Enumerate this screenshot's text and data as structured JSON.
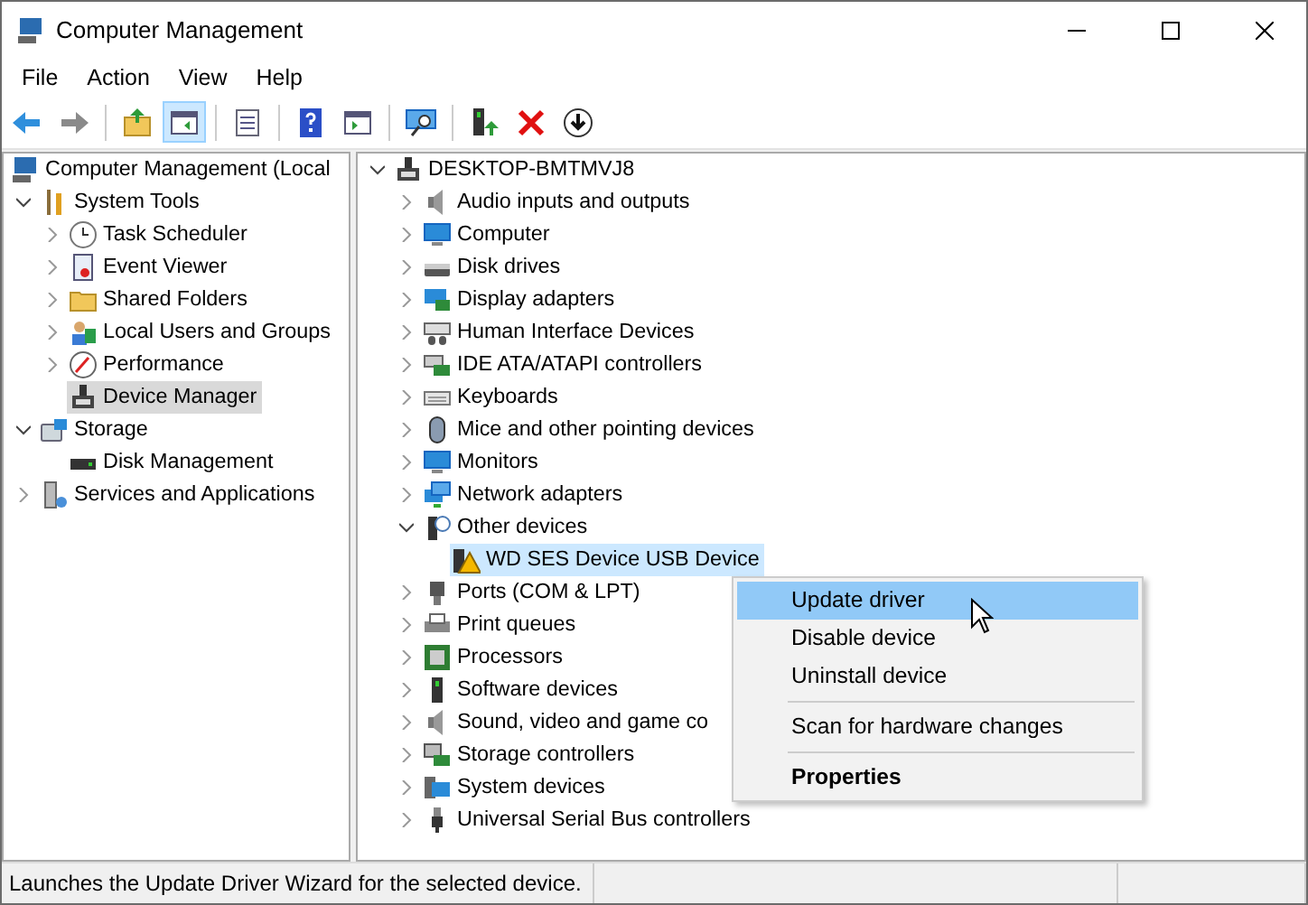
{
  "window": {
    "title": "Computer Management"
  },
  "menu_bar": [
    "File",
    "Action",
    "View",
    "Help"
  ],
  "console_tree": [
    {
      "label": "Computer Management (Local",
      "selected": false,
      "children": [
        {
          "label": "System Tools",
          "expanded": true,
          "selected": false,
          "children": [
            {
              "label": "Task Scheduler",
              "expanded": false,
              "selected": false
            },
            {
              "label": "Event Viewer",
              "expanded": false,
              "selected": false
            },
            {
              "label": "Shared Folders",
              "expanded": false,
              "selected": false
            },
            {
              "label": "Local Users and Groups",
              "expanded": false,
              "selected": false
            },
            {
              "label": "Performance",
              "expanded": false,
              "selected": false
            },
            {
              "label": "Device Manager",
              "selected": true
            }
          ]
        },
        {
          "label": "Storage",
          "expanded": true,
          "selected": false,
          "children": [
            {
              "label": "Disk Management",
              "selected": false
            }
          ]
        },
        {
          "label": "Services and Applications",
          "expanded": false,
          "selected": false
        }
      ]
    }
  ],
  "device_tree": [
    {
      "label": "DESKTOP-BMTMVJ8",
      "expanded": true,
      "selected": false,
      "children": [
        {
          "label": "Audio inputs and outputs",
          "expanded": false,
          "selected": false
        },
        {
          "label": "Computer",
          "expanded": false,
          "selected": false
        },
        {
          "label": "Disk drives",
          "expanded": false,
          "selected": false
        },
        {
          "label": "Display adapters",
          "expanded": false,
          "selected": false
        },
        {
          "label": "Human Interface Devices",
          "expanded": false,
          "selected": false
        },
        {
          "label": "IDE ATA/ATAPI controllers",
          "expanded": false,
          "selected": false
        },
        {
          "label": "Keyboards",
          "expanded": false,
          "selected": false
        },
        {
          "label": "Mice and other pointing devices",
          "expanded": false,
          "selected": false
        },
        {
          "label": "Monitors",
          "expanded": false,
          "selected": false
        },
        {
          "label": "Network adapters",
          "expanded": false,
          "selected": false
        },
        {
          "label": "Other devices",
          "expanded": true,
          "selected": false,
          "children": [
            {
              "label": "WD SES Device USB Device",
              "selected": true
            }
          ]
        },
        {
          "label": "Ports (COM & LPT)",
          "expanded": false,
          "selected": false
        },
        {
          "label": "Print queues",
          "expanded": false,
          "selected": false
        },
        {
          "label": "Processors",
          "expanded": false,
          "selected": false
        },
        {
          "label": "Software devices",
          "expanded": false,
          "selected": false
        },
        {
          "label": "Sound, video and game co",
          "expanded": false,
          "selected": false
        },
        {
          "label": "Storage controllers",
          "expanded": false,
          "selected": false
        },
        {
          "label": "System devices",
          "expanded": false,
          "selected": false
        },
        {
          "label": "Universal Serial Bus controllers",
          "expanded": false,
          "selected": false
        }
      ]
    }
  ],
  "context_menu": [
    [
      {
        "label": "Update driver",
        "selected": true,
        "bold": false
      },
      {
        "label": "Disable device",
        "selected": false,
        "bold": false
      },
      {
        "label": "Uninstall device",
        "selected": false,
        "bold": false
      }
    ],
    [
      {
        "label": "Scan for hardware changes",
        "selected": false,
        "bold": false
      }
    ],
    [
      {
        "label": "Properties",
        "selected": false,
        "bold": true
      }
    ]
  ],
  "status_bar": {
    "text": "Launches the Update Driver Wizard for the selected device."
  }
}
